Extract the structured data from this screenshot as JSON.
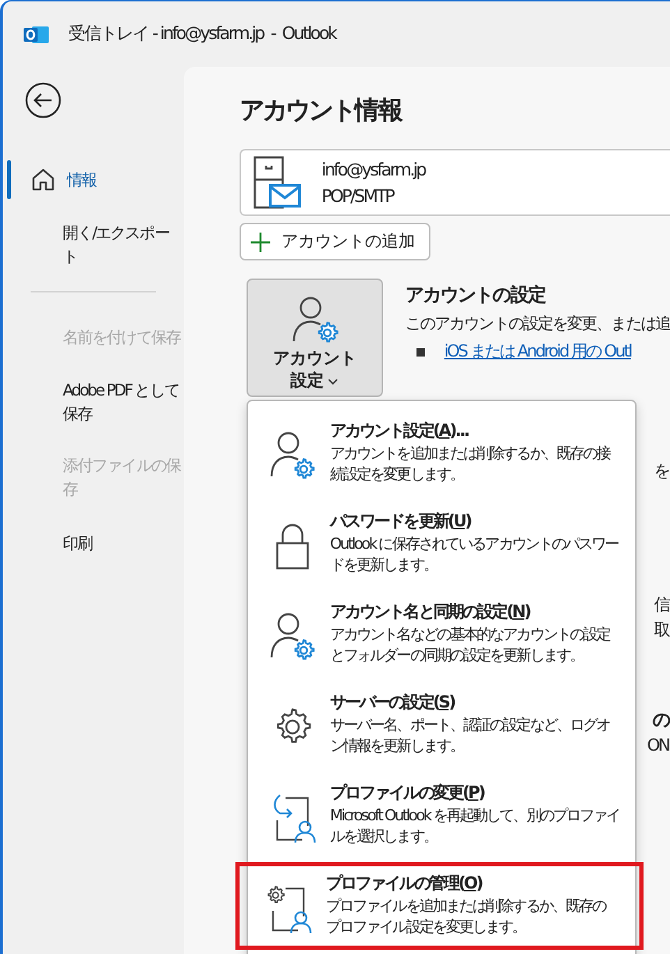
{
  "window": {
    "title": "受信トレイ - info@ysfarm.jp  -  Outlook"
  },
  "sidebar": {
    "items": [
      {
        "label": "情報",
        "selected": true,
        "disabled": false,
        "kind": "home"
      },
      {
        "label": "開く/エクスポート",
        "selected": false,
        "disabled": false,
        "kind": "plain"
      },
      {
        "kind": "divider"
      },
      {
        "label": "名前を付けて保存",
        "selected": false,
        "disabled": true,
        "kind": "plain"
      },
      {
        "label": "Adobe PDF として保存",
        "selected": false,
        "disabled": false,
        "kind": "plain"
      },
      {
        "label": "添付ファイルの保存",
        "selected": false,
        "disabled": true,
        "kind": "plain"
      },
      {
        "label": "印刷",
        "selected": false,
        "disabled": false,
        "kind": "plain"
      }
    ]
  },
  "page": {
    "title": "アカウント情報",
    "account": {
      "email": "info@ysfarm.jp",
      "type": "POP/SMTP"
    },
    "add_account_button": "アカウントの追加",
    "settings_button": "アカウント設定",
    "settings_section": {
      "title": "アカウントの設定",
      "description": "このアカウントの設定を変更、または追",
      "link": "iOS または Android 用の Outl"
    },
    "hidden_fragments": [
      "を",
      "信",
      "取",
      "の",
      "ON"
    ]
  },
  "dropdown": {
    "items": [
      {
        "kind": "person-gear",
        "before": "アカウント設定(",
        "key": "A",
        "after": ")...",
        "description": "アカウントを追加または削除するか、既存の接続設定を変更します。",
        "highlighted": false
      },
      {
        "kind": "lock",
        "before": "パスワードを更新(",
        "key": "U",
        "after": ")",
        "description": "Outlook に保存されているアカウントのパスワードを更新します。",
        "highlighted": false
      },
      {
        "kind": "person-gear",
        "before": "アカウント名と同期の設定(",
        "key": "N",
        "after": ")",
        "description": "アカウント名などの基本的なアカウントの設定とフォルダーの同期の設定を更新します。",
        "highlighted": false
      },
      {
        "kind": "gear",
        "before": "サーバーの設定(",
        "key": "S",
        "after": ")",
        "description": "サーバー名、ポート、認証の設定など、ログオン情報を更新します。",
        "highlighted": false
      },
      {
        "kind": "profile-switch",
        "before": "プロファイルの変更(",
        "key": "P",
        "after": ")",
        "description": "Microsoft Outlook を再起動して、別のプロファイルを選択します。",
        "highlighted": false
      },
      {
        "kind": "profile-gear",
        "before": "プロファイルの管理(",
        "key": "O",
        "after": ")",
        "description": "プロファイルを追加または削除するか、既存のプロファイル設定を変更します。",
        "highlighted": true
      }
    ]
  }
}
